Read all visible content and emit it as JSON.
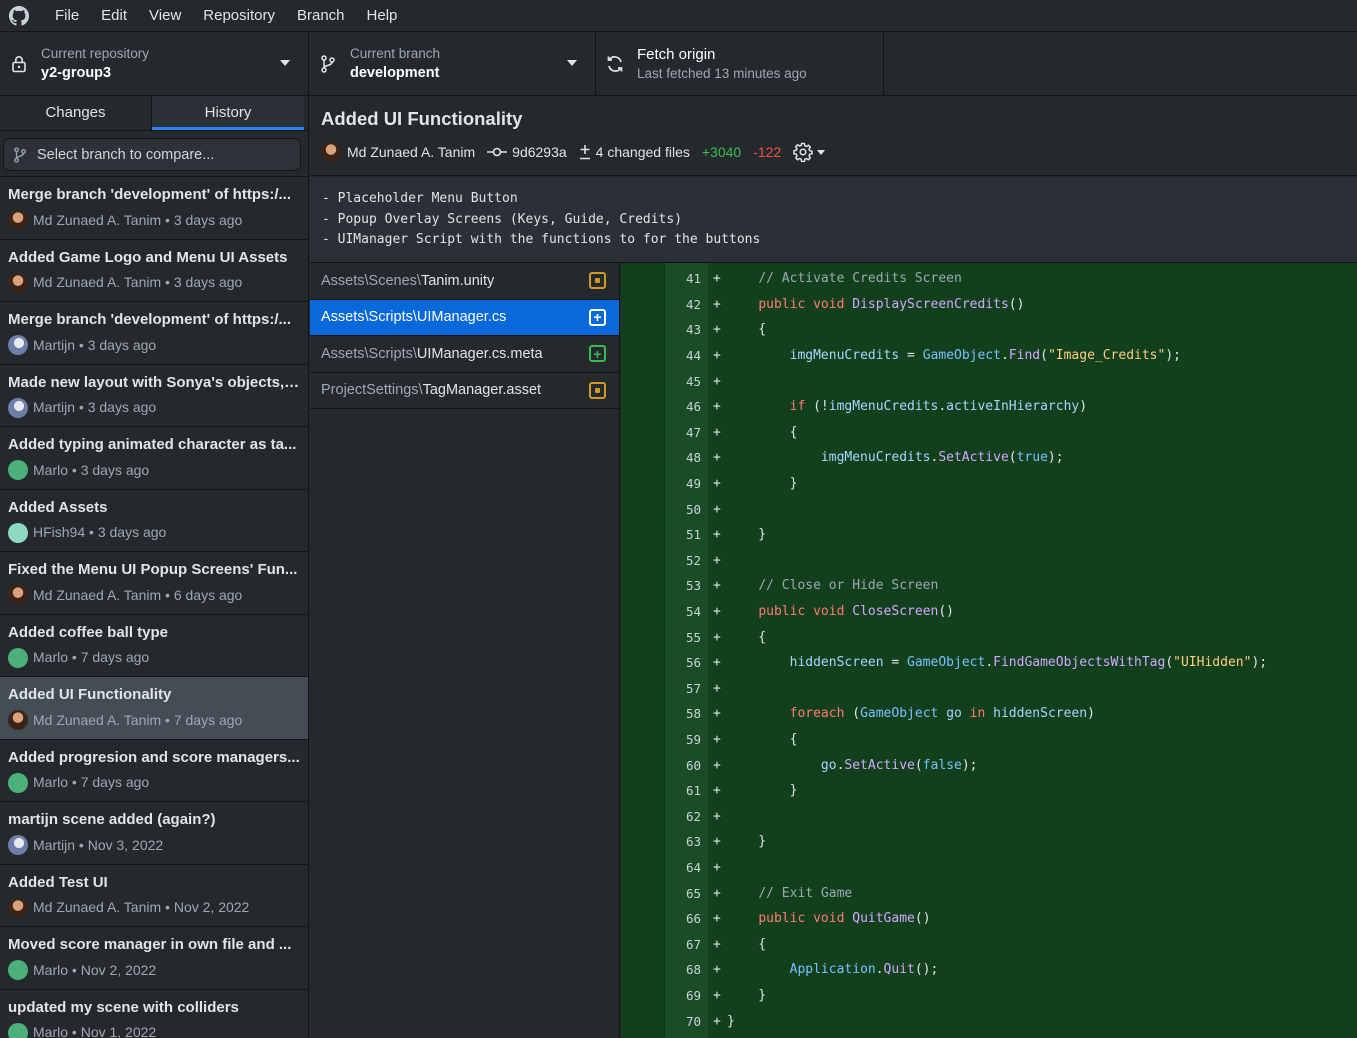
{
  "menu": [
    "File",
    "Edit",
    "View",
    "Repository",
    "Branch",
    "Help"
  ],
  "toolbar": {
    "repo_label": "Current repository",
    "repo_name": "y2-group3",
    "branch_label": "Current branch",
    "branch_name": "development",
    "fetch_title": "Fetch origin",
    "fetch_sub": "Last fetched 13 minutes ago"
  },
  "sidebar": {
    "tabs": [
      "Changes",
      "History"
    ],
    "active_tab": "History",
    "compare_placeholder": "Select branch to compare...",
    "commits": [
      {
        "title": "Merge branch 'development' of https:/...",
        "author": "Md Zunaed A. Tanim",
        "when": "3 days ago",
        "avatar": "tanim"
      },
      {
        "title": "Added Game Logo and Menu UI Assets",
        "author": "Md Zunaed A. Tanim",
        "when": "3 days ago",
        "avatar": "tanim"
      },
      {
        "title": "Merge branch 'development' of https:/...",
        "author": "Martijn",
        "when": "3 days ago",
        "avatar": "martijn"
      },
      {
        "title": "Made new layout with Sonya's objects, ...",
        "author": "Martijn",
        "when": "3 days ago",
        "avatar": "martijn"
      },
      {
        "title": "Added typing animated character as ta...",
        "author": "Marlo",
        "when": "3 days ago",
        "avatar": "marlo"
      },
      {
        "title": "Added Assets",
        "author": "HFish94",
        "when": "3 days ago",
        "avatar": "hfish"
      },
      {
        "title": "Fixed the Menu UI Popup Screens' Fun...",
        "author": "Md Zunaed A. Tanim",
        "when": "6 days ago",
        "avatar": "tanim"
      },
      {
        "title": "Added coffee ball type",
        "author": "Marlo",
        "when": "7 days ago",
        "avatar": "marlo"
      },
      {
        "title": "Added UI Functionality",
        "author": "Md Zunaed A. Tanim",
        "when": "7 days ago",
        "avatar": "tanim",
        "selected": true
      },
      {
        "title": "Added progresion and score managers...",
        "author": "Marlo",
        "when": "7 days ago",
        "avatar": "marlo"
      },
      {
        "title": "martijn scene added (again?)",
        "author": "Martijn",
        "when": "Nov 3, 2022",
        "avatar": "martijn"
      },
      {
        "title": "Added Test UI",
        "author": "Md Zunaed A. Tanim",
        "when": "Nov 2, 2022",
        "avatar": "tanim"
      },
      {
        "title": "Moved score manager in own file and ...",
        "author": "Marlo",
        "when": "Nov 2, 2022",
        "avatar": "marlo"
      },
      {
        "title": "updated my scene with colliders",
        "author": "Marlo",
        "when": "Nov 1, 2022",
        "avatar": "marlo"
      }
    ]
  },
  "commit": {
    "title": "Added UI Functionality",
    "author": "Md Zunaed A. Tanim",
    "sha": "9d6293a",
    "changed_files": "4 changed files",
    "additions": "+3040",
    "deletions": "-122",
    "description": [
      "- Placeholder Menu Button",
      "- Popup Overlay Screens (Keys, Guide, Credits)",
      "- UIManager Script with the functions to for the buttons"
    ]
  },
  "files": [
    {
      "dir": "Assets\\Scenes\\",
      "name": "Tanim.unity",
      "status": "modified"
    },
    {
      "dir": "Assets\\Scripts\\",
      "name": "UIManager.cs",
      "status": "added",
      "selected": true
    },
    {
      "dir": "Assets\\Scripts\\",
      "name": "UIManager.cs.meta",
      "status": "added"
    },
    {
      "dir": "ProjectSettings\\",
      "name": "TagManager.asset",
      "status": "modified"
    }
  ],
  "diff": {
    "lines": [
      {
        "n": "41",
        "sign": "+",
        "code": [
          [
            "    ",
            ""
          ],
          [
            "// Activate Credits Screen",
            "cm"
          ]
        ]
      },
      {
        "n": "42",
        "sign": "+",
        "code": [
          [
            "    ",
            ""
          ],
          [
            "public",
            "kw"
          ],
          [
            " ",
            ""
          ],
          [
            "void",
            "kw"
          ],
          [
            " ",
            ""
          ],
          [
            "DisplayScreenCredits",
            "fn"
          ],
          [
            "()",
            ""
          ]
        ]
      },
      {
        "n": "43",
        "sign": "+",
        "code": [
          [
            "    {",
            ""
          ]
        ]
      },
      {
        "n": "44",
        "sign": "+",
        "code": [
          [
            "        ",
            ""
          ],
          [
            "imgMenuCredits",
            "var"
          ],
          [
            " = ",
            ""
          ],
          [
            "GameObject",
            "id"
          ],
          [
            ".",
            ""
          ],
          [
            "Find",
            "fn"
          ],
          [
            "(",
            ""
          ],
          [
            "\"Image_Credits\"",
            "str"
          ],
          [
            ");",
            ""
          ]
        ]
      },
      {
        "n": "45",
        "sign": "+",
        "code": []
      },
      {
        "n": "46",
        "sign": "+",
        "code": [
          [
            "        ",
            ""
          ],
          [
            "if",
            "kw"
          ],
          [
            " (!",
            ""
          ],
          [
            "imgMenuCredits",
            "var"
          ],
          [
            ".",
            ""
          ],
          [
            "activeInHierarchy",
            "var"
          ],
          [
            ")",
            ""
          ]
        ]
      },
      {
        "n": "47",
        "sign": "+",
        "code": [
          [
            "        {",
            ""
          ]
        ]
      },
      {
        "n": "48",
        "sign": "+",
        "code": [
          [
            "            ",
            ""
          ],
          [
            "imgMenuCredits",
            "var"
          ],
          [
            ".",
            ""
          ],
          [
            "SetActive",
            "fn"
          ],
          [
            "(",
            ""
          ],
          [
            "true",
            "bool"
          ],
          [
            ");",
            ""
          ]
        ]
      },
      {
        "n": "49",
        "sign": "+",
        "code": [
          [
            "        }",
            ""
          ]
        ]
      },
      {
        "n": "50",
        "sign": "+",
        "code": []
      },
      {
        "n": "51",
        "sign": "+",
        "code": [
          [
            "    }",
            ""
          ]
        ]
      },
      {
        "n": "52",
        "sign": "+",
        "code": []
      },
      {
        "n": "53",
        "sign": "+",
        "code": [
          [
            "    ",
            ""
          ],
          [
            "// Close or Hide Screen",
            "cm"
          ]
        ]
      },
      {
        "n": "54",
        "sign": "+",
        "code": [
          [
            "    ",
            ""
          ],
          [
            "public",
            "kw"
          ],
          [
            " ",
            ""
          ],
          [
            "void",
            "kw"
          ],
          [
            " ",
            ""
          ],
          [
            "CloseScreen",
            "fn"
          ],
          [
            "()",
            ""
          ]
        ]
      },
      {
        "n": "55",
        "sign": "+",
        "code": [
          [
            "    {",
            ""
          ]
        ]
      },
      {
        "n": "56",
        "sign": "+",
        "code": [
          [
            "        ",
            ""
          ],
          [
            "hiddenScreen",
            "var"
          ],
          [
            " = ",
            ""
          ],
          [
            "GameObject",
            "id"
          ],
          [
            ".",
            ""
          ],
          [
            "FindGameObjectsWithTag",
            "fn"
          ],
          [
            "(",
            ""
          ],
          [
            "\"UIHidden\"",
            "str"
          ],
          [
            ");",
            ""
          ]
        ]
      },
      {
        "n": "57",
        "sign": "+",
        "code": []
      },
      {
        "n": "58",
        "sign": "+",
        "code": [
          [
            "        ",
            ""
          ],
          [
            "foreach",
            "kw"
          ],
          [
            " (",
            ""
          ],
          [
            "GameObject",
            "id"
          ],
          [
            " ",
            ""
          ],
          [
            "go",
            "var"
          ],
          [
            " ",
            ""
          ],
          [
            "in",
            "kw"
          ],
          [
            " ",
            ""
          ],
          [
            "hiddenScreen",
            "var"
          ],
          [
            ")",
            ""
          ]
        ]
      },
      {
        "n": "59",
        "sign": "+",
        "code": [
          [
            "        {",
            ""
          ]
        ]
      },
      {
        "n": "60",
        "sign": "+",
        "code": [
          [
            "            ",
            ""
          ],
          [
            "go",
            "var"
          ],
          [
            ".",
            ""
          ],
          [
            "SetActive",
            "fn"
          ],
          [
            "(",
            ""
          ],
          [
            "false",
            "bool"
          ],
          [
            ");",
            ""
          ]
        ]
      },
      {
        "n": "61",
        "sign": "+",
        "code": [
          [
            "        }",
            ""
          ]
        ]
      },
      {
        "n": "62",
        "sign": "+",
        "code": []
      },
      {
        "n": "63",
        "sign": "+",
        "code": [
          [
            "    }",
            ""
          ]
        ]
      },
      {
        "n": "64",
        "sign": "+",
        "code": []
      },
      {
        "n": "65",
        "sign": "+",
        "code": [
          [
            "    ",
            ""
          ],
          [
            "// Exit Game",
            "cm"
          ]
        ]
      },
      {
        "n": "66",
        "sign": "+",
        "code": [
          [
            "    ",
            ""
          ],
          [
            "public",
            "kw"
          ],
          [
            " ",
            ""
          ],
          [
            "void",
            "kw"
          ],
          [
            " ",
            ""
          ],
          [
            "QuitGame",
            "fn"
          ],
          [
            "()",
            ""
          ]
        ]
      },
      {
        "n": "67",
        "sign": "+",
        "code": [
          [
            "    {",
            ""
          ]
        ]
      },
      {
        "n": "68",
        "sign": "+",
        "code": [
          [
            "        ",
            ""
          ],
          [
            "Application",
            "id"
          ],
          [
            ".",
            ""
          ],
          [
            "Quit",
            "fn"
          ],
          [
            "();",
            ""
          ]
        ]
      },
      {
        "n": "69",
        "sign": "+",
        "code": [
          [
            "    }",
            ""
          ]
        ]
      },
      {
        "n": "70",
        "sign": "+",
        "code": [
          [
            "}",
            ""
          ]
        ]
      }
    ]
  },
  "colors": {
    "accent": "#2f81f7",
    "selected_file": "#0969da",
    "additions": "#3fb950",
    "deletions": "#f85149",
    "modified": "#d29922",
    "diff_bg": "#12401d"
  }
}
